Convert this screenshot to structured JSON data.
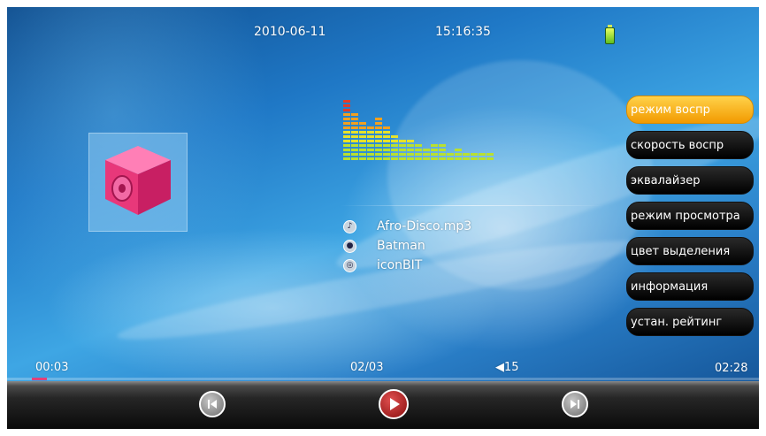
{
  "status": {
    "date": "2010-06-11",
    "time": "15:16:35",
    "battery_icon": "battery-full-icon",
    "battery_color": "#7ed321"
  },
  "album_art": {
    "icon": "speaker-cube-icon",
    "color": "#e8387a"
  },
  "track": {
    "title": "Afro-Disco.mp3",
    "artist": "Batman",
    "album": "iconBIT",
    "title_icon": "music-note-icon",
    "artist_icon": "person-icon",
    "album_icon": "disc-icon"
  },
  "menu": {
    "items": [
      {
        "label": "режим воспр",
        "active": true
      },
      {
        "label": "скорость воспр",
        "active": false
      },
      {
        "label": "эквалайзер",
        "active": false
      },
      {
        "label": "режим просмотра",
        "active": false
      },
      {
        "label": "цвет выделения",
        "active": false
      },
      {
        "label": "информация",
        "active": false
      },
      {
        "label": "устан. рейтинг",
        "active": false
      }
    ],
    "active_color": "#f5a800"
  },
  "playback": {
    "elapsed": "00:03",
    "track_counter": "02/03",
    "volume": "15",
    "volume_icon": "speaker-icon",
    "total": "02:28",
    "progress_fraction": 0.02
  },
  "controls": {
    "prev_icon": "skip-back-icon",
    "play_icon": "play-icon",
    "next_icon": "skip-forward-icon",
    "play_color": "#c0201f"
  }
}
